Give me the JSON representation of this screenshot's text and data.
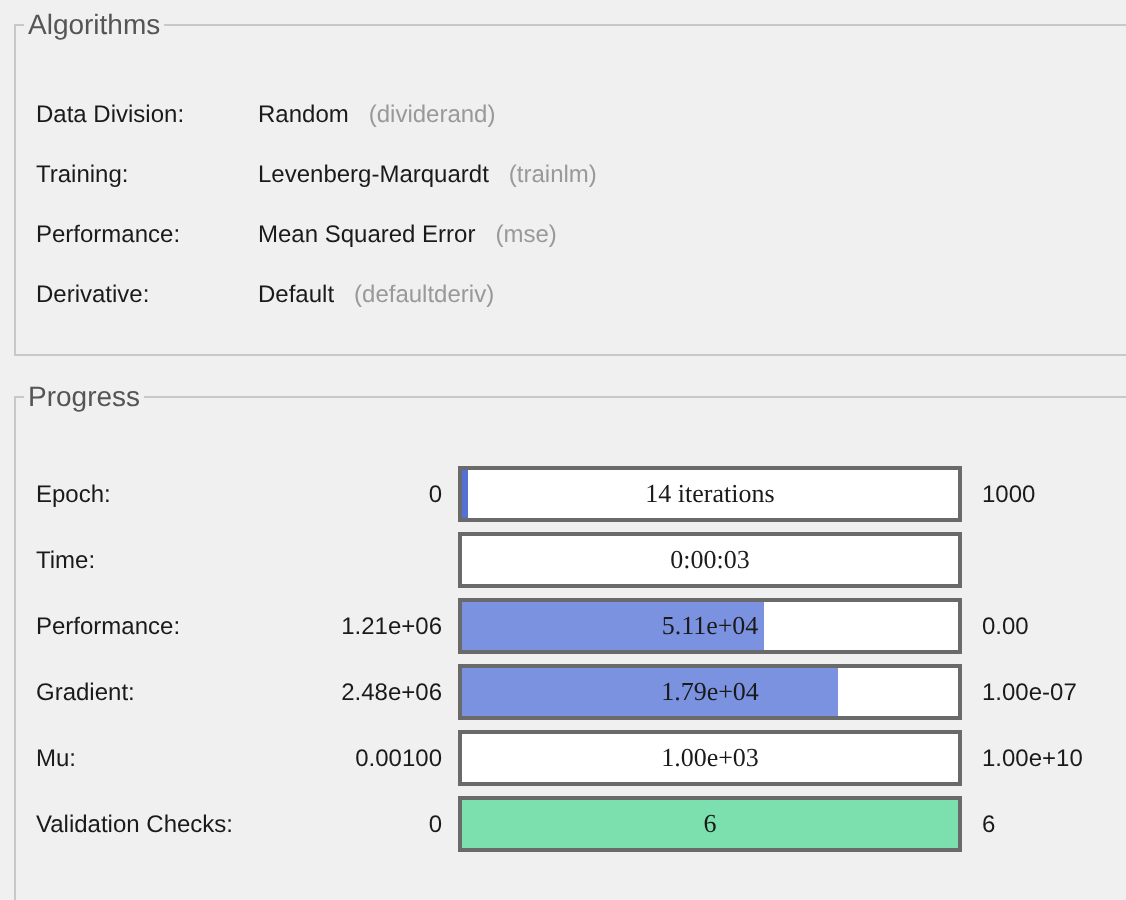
{
  "algorithms": {
    "title": "Algorithms",
    "rows": [
      {
        "label": "Data Division:",
        "value": "Random",
        "function": "(dividerand)"
      },
      {
        "label": "Training:",
        "value": "Levenberg-Marquardt",
        "function": "(trainlm)"
      },
      {
        "label": "Performance:",
        "value": "Mean Squared Error",
        "function": "(mse)"
      },
      {
        "label": "Derivative:",
        "value": "Default",
        "function": "(defaultderiv)"
      }
    ]
  },
  "progress": {
    "title": "Progress",
    "rows": [
      {
        "label": "Epoch:",
        "start": "0",
        "reading": "14 iterations",
        "end": "1000",
        "level": 0.014,
        "color": "#5470d4"
      },
      {
        "label": "Time:",
        "reading": "0:00:03",
        "level": 0
      },
      {
        "label": "Performance:",
        "start": "1.21e+06",
        "reading": "5.11e+04",
        "end": "0.00",
        "level": 0.61,
        "color": "#7b92e0"
      },
      {
        "label": "Gradient:",
        "start": "2.48e+06",
        "reading": "1.79e+04",
        "end": "1.00e-07",
        "level": 0.76,
        "color": "#7b92e0"
      },
      {
        "label": "Mu:",
        "start": "0.00100",
        "reading": "1.00e+03",
        "end": "1.00e+10",
        "level": 0
      },
      {
        "label": "Validation Checks:",
        "start": "0",
        "reading": "6",
        "end": "6",
        "level": 1,
        "color": "#7be0ad"
      }
    ]
  }
}
